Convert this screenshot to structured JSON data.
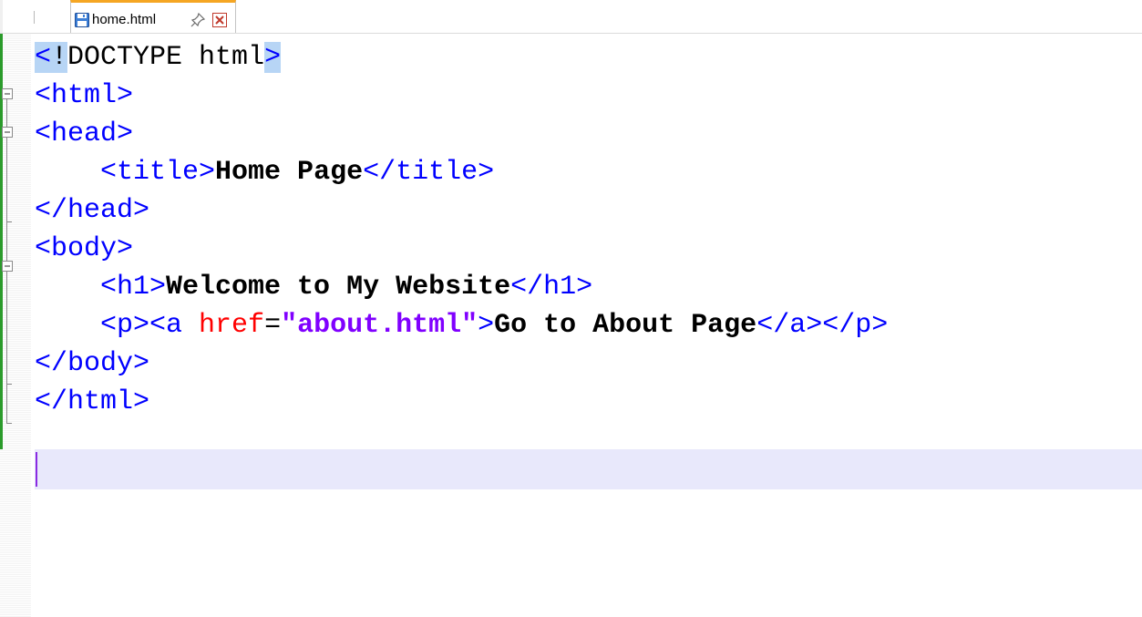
{
  "tab": {
    "filename": "home.html",
    "file_icon": "floppy-disk-icon",
    "pin_icon": "pin-icon",
    "close_icon": "close-icon"
  },
  "editor": {
    "lines": [
      {
        "tokens": [
          {
            "t": "<",
            "c": "tag-hl"
          },
          {
            "t": "!",
            "c": "doctype-hl"
          },
          {
            "t": "DOCTYPE html",
            "c": "doctype"
          },
          {
            "t": ">",
            "c": "tag-hl"
          }
        ]
      },
      {
        "tokens": [
          {
            "t": "<html>",
            "c": "tag"
          }
        ]
      },
      {
        "tokens": [
          {
            "t": "<head>",
            "c": "tag"
          }
        ]
      },
      {
        "tokens": [
          {
            "t": "    ",
            "c": "txt"
          },
          {
            "t": "<title>",
            "c": "tag"
          },
          {
            "t": "Home Page",
            "c": "txt"
          },
          {
            "t": "</title>",
            "c": "tag"
          }
        ]
      },
      {
        "tokens": [
          {
            "t": "</head>",
            "c": "tag"
          }
        ]
      },
      {
        "tokens": [
          {
            "t": "<body>",
            "c": "tag"
          }
        ]
      },
      {
        "tokens": [
          {
            "t": "    ",
            "c": "txt"
          },
          {
            "t": "<h1>",
            "c": "tag"
          },
          {
            "t": "Welcome to My Website",
            "c": "txt"
          },
          {
            "t": "</h1>",
            "c": "tag"
          }
        ]
      },
      {
        "tokens": [
          {
            "t": "    ",
            "c": "txt"
          },
          {
            "t": "<p><a ",
            "c": "tag"
          },
          {
            "t": "href",
            "c": "attr"
          },
          {
            "t": "=",
            "c": "eq"
          },
          {
            "t": "\"about.html\"",
            "c": "str"
          },
          {
            "t": ">",
            "c": "tag"
          },
          {
            "t": "Go to About Page",
            "c": "txt"
          },
          {
            "t": "</a></p>",
            "c": "tag"
          }
        ]
      },
      {
        "tokens": [
          {
            "t": "</body>",
            "c": "tag"
          }
        ]
      },
      {
        "tokens": [
          {
            "t": "</html>",
            "c": "tag"
          }
        ]
      },
      {
        "tokens": []
      }
    ]
  },
  "colors": {
    "tag": "#0000ff",
    "attribute": "#ff0000",
    "string": "#8000ff",
    "text": "#000000",
    "change_bar": "#2b9b2b",
    "tab_accent": "#f5a623",
    "current_line": "#e8e8fb",
    "brace_highlight": "#b7d5f5"
  }
}
